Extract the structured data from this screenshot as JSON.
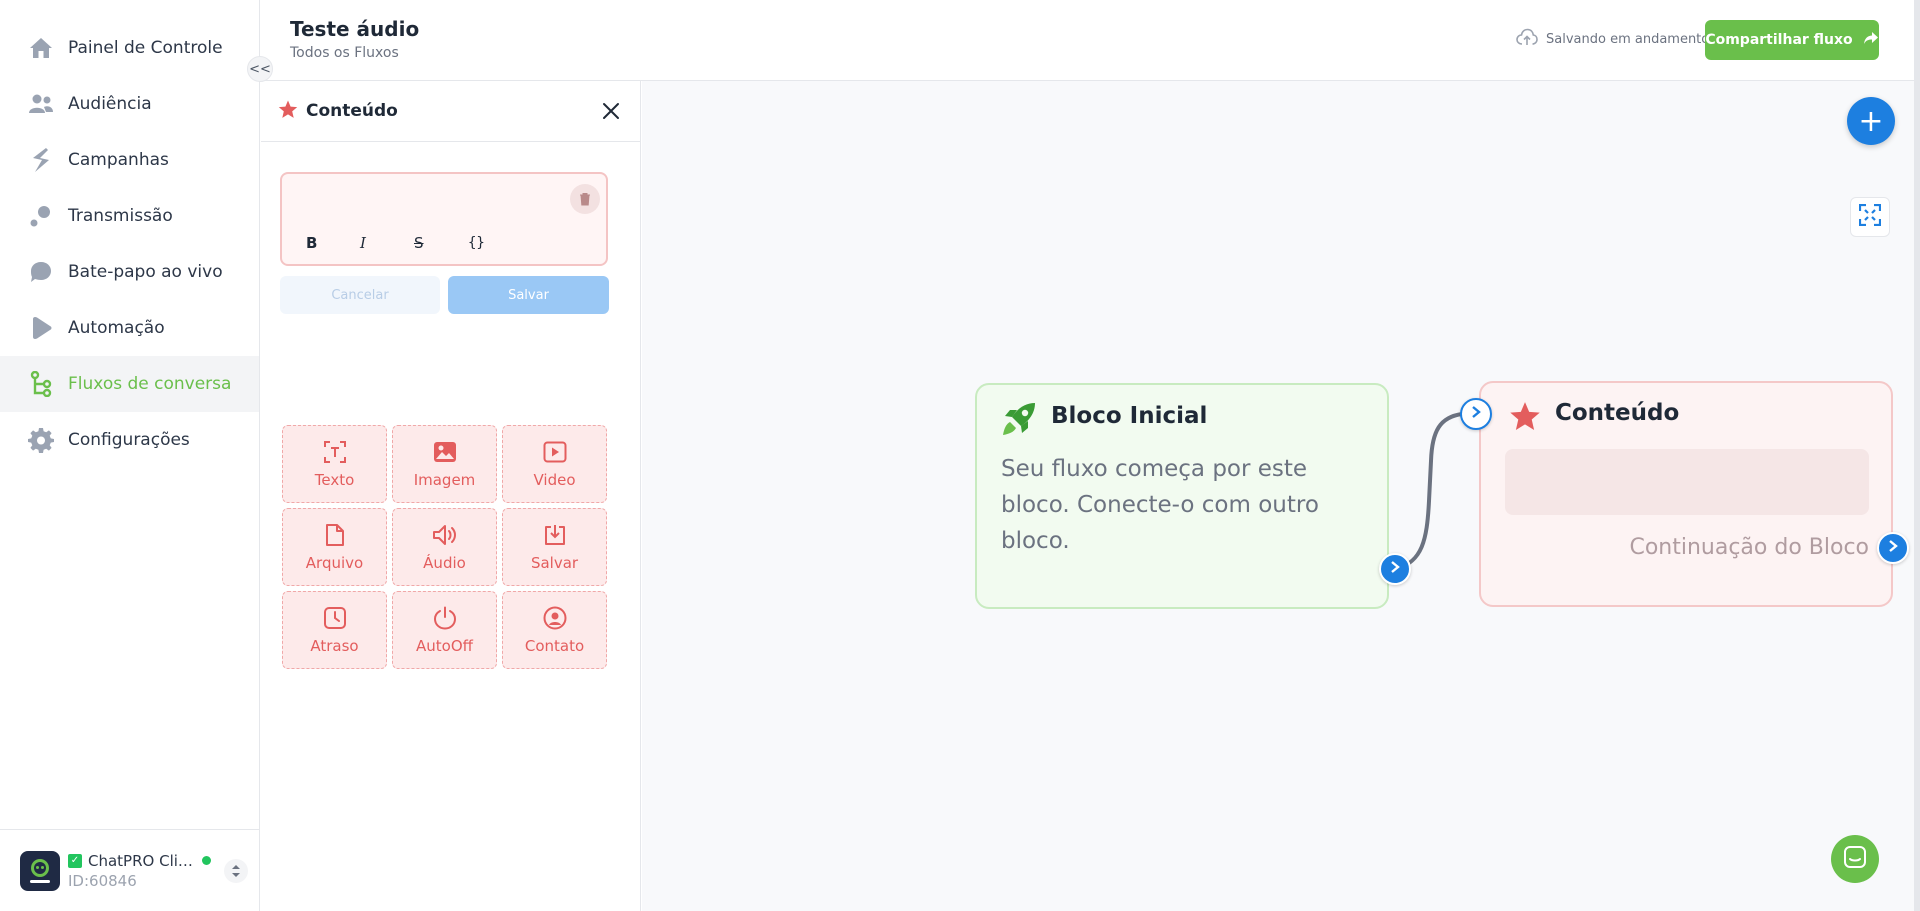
{
  "sidebar": {
    "items": [
      {
        "label": "Painel de Controle",
        "icon": "home-icon",
        "active": false
      },
      {
        "label": "Audiência",
        "icon": "users-icon",
        "active": false
      },
      {
        "label": "Campanhas",
        "icon": "campaign-icon",
        "active": false
      },
      {
        "label": "Transmissão",
        "icon": "broadcast-icon",
        "active": false
      },
      {
        "label": "Bate-papo ao vivo",
        "icon": "chat-bubble-icon",
        "active": false
      },
      {
        "label": "Automação",
        "icon": "automation-icon",
        "active": false
      },
      {
        "label": "Fluxos de conversa",
        "icon": "flow-icon",
        "active": true
      },
      {
        "label": "Configurações",
        "icon": "gear-icon",
        "active": false
      }
    ],
    "collapse_label": "<<",
    "account": {
      "name": "ChatPRO Clie...",
      "id": "ID:60846"
    }
  },
  "header": {
    "title": "Teste áudio",
    "breadcrumb": "Todos os Fluxos",
    "status": "Salvando em andamento",
    "share_label": "Compartilhar fluxo"
  },
  "panel": {
    "title": "Conteúdo",
    "editor_value": "",
    "format_buttons": [
      "B",
      "I",
      "S",
      "{}"
    ],
    "cancel_label": "Cancelar",
    "save_label": "Salvar",
    "tiles": [
      {
        "label": "Texto",
        "icon": "text-icon"
      },
      {
        "label": "Imagem",
        "icon": "image-icon"
      },
      {
        "label": "Video",
        "icon": "video-icon"
      },
      {
        "label": "Arquivo",
        "icon": "file-icon"
      },
      {
        "label": "Áudio",
        "icon": "audio-icon"
      },
      {
        "label": "Salvar",
        "icon": "download-icon"
      },
      {
        "label": "Atraso",
        "icon": "clock-icon"
      },
      {
        "label": "AutoOff",
        "icon": "power-icon"
      },
      {
        "label": "Contato",
        "icon": "contact-icon"
      }
    ]
  },
  "canvas": {
    "start_block": {
      "title": "Bloco Inicial",
      "description": "Seu fluxo começa por este bloco. Conecte-o com outro bloco."
    },
    "content_block": {
      "title": "Conteúdo",
      "continuation": "Continuação do Bloco"
    }
  },
  "colors": {
    "brand_green": "#6abf4b",
    "accent_blue": "#1d7fe0",
    "content_red": "#e35d5d"
  }
}
